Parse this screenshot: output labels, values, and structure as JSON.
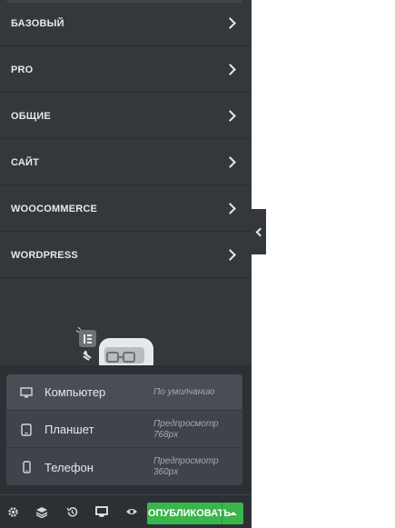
{
  "categories": [
    {
      "label": "БАЗОВЫЙ"
    },
    {
      "label": "PRO"
    },
    {
      "label": "ОБЩИЕ"
    },
    {
      "label": "САЙТ"
    },
    {
      "label": "WOOCOMMERCE"
    },
    {
      "label": "WORDPRESS"
    }
  ],
  "responsive_menu": {
    "devices": [
      {
        "name": "Компьютер",
        "hint": "По умолчанию",
        "icon": "desktop-icon",
        "active": true
      },
      {
        "name": "Планшет",
        "hint": "Предпросмотр 768px",
        "icon": "tablet-icon",
        "active": false
      },
      {
        "name": "Телефон",
        "hint": "Предпросмотр 360px",
        "icon": "mobile-icon",
        "active": false
      }
    ]
  },
  "footer": {
    "icons": [
      "gear-icon",
      "layers-icon",
      "history-icon",
      "desktop-icon",
      "eye-icon"
    ],
    "publish_label": "ОПУБЛИКОВАТЬ"
  },
  "colors": {
    "panel_bg": "#34383c",
    "publish_green": "#39b54a",
    "text": "#e6e8ea"
  }
}
